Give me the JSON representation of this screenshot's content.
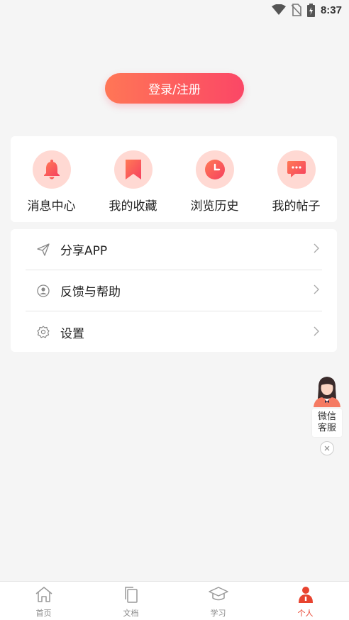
{
  "status_bar": {
    "time": "8:37"
  },
  "login": {
    "label": "登录/注册"
  },
  "quick_actions": [
    {
      "label": "消息中心",
      "icon": "bell-icon"
    },
    {
      "label": "我的收藏",
      "icon": "bookmark-icon"
    },
    {
      "label": "浏览历史",
      "icon": "clock-icon"
    },
    {
      "label": "我的帖子",
      "icon": "chat-icon"
    }
  ],
  "menu": [
    {
      "label": "分享APP",
      "icon": "send-icon"
    },
    {
      "label": "反馈与帮助",
      "icon": "user-circle-icon"
    },
    {
      "label": "设置",
      "icon": "gear-icon"
    }
  ],
  "wechat_service": {
    "line1": "微信",
    "line2": "客服"
  },
  "tabbar": [
    {
      "label": "首页",
      "icon": "home-icon",
      "active": false
    },
    {
      "label": "文档",
      "icon": "document-icon",
      "active": false
    },
    {
      "label": "学习",
      "icon": "graduation-cap-icon",
      "active": false
    },
    {
      "label": "个人",
      "icon": "person-icon",
      "active": true
    }
  ],
  "colors": {
    "accent": "#fb4766",
    "accent_light": "#ffd9d3",
    "tab_active": "#e8432f"
  }
}
